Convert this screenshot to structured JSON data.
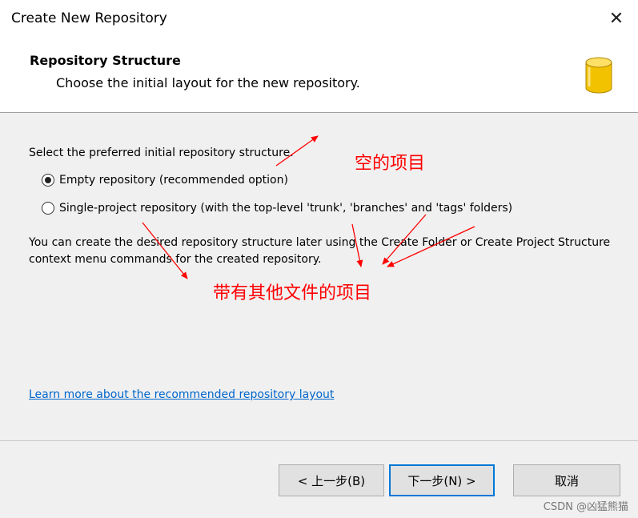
{
  "window": {
    "title": "Create New Repository",
    "close_glyph": "✕"
  },
  "header": {
    "title": "Repository Structure",
    "subtitle": "Choose the initial layout for the new repository.",
    "icon": "database-icon",
    "icon_color": "#f2c200"
  },
  "content": {
    "prompt": "Select the preferred initial repository structure.",
    "options": [
      {
        "label": "Empty repository (recommended option)",
        "selected": true
      },
      {
        "label": "Single-project repository (with the top-level 'trunk', 'branches' and 'tags' folders)",
        "selected": false
      }
    ],
    "note": "You can create the desired repository structure later using the Create Folder or Create Project Structure context menu commands for the created repository.",
    "link": "Learn more about the recommended repository layout"
  },
  "annotations": {
    "empty": "空的项目",
    "with_files": "带有其他文件的项目",
    "color": "#ff0000"
  },
  "footer": {
    "back": "< 上一步(B)",
    "next": "下一步(N) >",
    "cancel": "取消"
  },
  "watermark": "CSDN @凶猛熊猫"
}
